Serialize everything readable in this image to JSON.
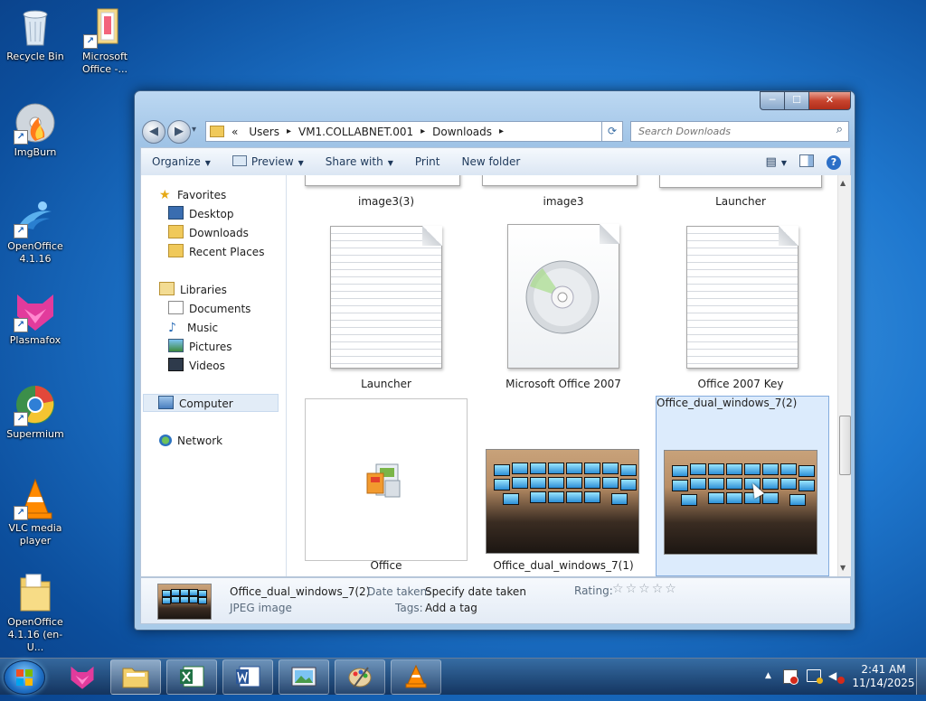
{
  "desktop": {
    "icons": [
      {
        "label": "Recycle Bin",
        "icon": "recycle-bin-icon"
      },
      {
        "label": "Microsoft Office -...",
        "icon": "folder-icon"
      },
      {
        "label": "ImgBurn",
        "icon": "imgburn-icon"
      },
      {
        "label": "OpenOffice 4.1.16",
        "icon": "openoffice-icon"
      },
      {
        "label": "Plasmafox",
        "icon": "plasmafox-icon"
      },
      {
        "label": "Supermium",
        "icon": "supermium-icon"
      },
      {
        "label": "VLC media player",
        "icon": "vlc-icon"
      },
      {
        "label": "OpenOffice 4.1.16 (en-U...",
        "icon": "folder-icon"
      }
    ]
  },
  "window": {
    "controls": {
      "minimize": "─",
      "maximize": "☐",
      "close": "✕"
    },
    "nav": {
      "back": "◀",
      "forward": "▶",
      "recent": "▾"
    },
    "address": {
      "prefix": "«",
      "crumbs": [
        "Users",
        "VM1.COLLABNET.001",
        "Downloads"
      ],
      "separator": "▸",
      "dropdown": "▾",
      "refresh": "⟳"
    },
    "search": {
      "placeholder": "Search Downloads",
      "icon": "⌕"
    },
    "toolbar": {
      "organize": "Organize",
      "preview": "Preview",
      "share_with": "Share with",
      "print": "Print",
      "new_folder": "New folder",
      "views": "▤",
      "help": "?"
    },
    "navpane": {
      "favorites": "Favorites",
      "desktop": "Desktop",
      "downloads": "Downloads",
      "recent_places": "Recent Places",
      "libraries": "Libraries",
      "documents": "Documents",
      "music": "Music",
      "pictures": "Pictures",
      "videos": "Videos",
      "computer": "Computer",
      "network": "Network"
    },
    "files": {
      "row0": [
        "image3(3)",
        "image3",
        "Launcher"
      ],
      "row1": [
        "Launcher",
        "Microsoft Office 2007",
        "Office 2007 Key"
      ],
      "row2": [
        "Office",
        "Office_dual_windows_7(1)",
        "Office_dual_windows_7(2)"
      ]
    },
    "details": {
      "name": "Office_dual_windows_7(2)",
      "type": "JPEG image",
      "date_label": "Date taken:",
      "date_value": "Specify date taken",
      "tags_label": "Tags:",
      "tags_value": "Add a tag",
      "rating_label": "Rating:",
      "rating_value": 0,
      "rating_max": 5
    }
  },
  "taskbar": {
    "clock_time": "2:41 AM",
    "clock_date": "11/14/2025",
    "tray_arrow": "▲"
  }
}
